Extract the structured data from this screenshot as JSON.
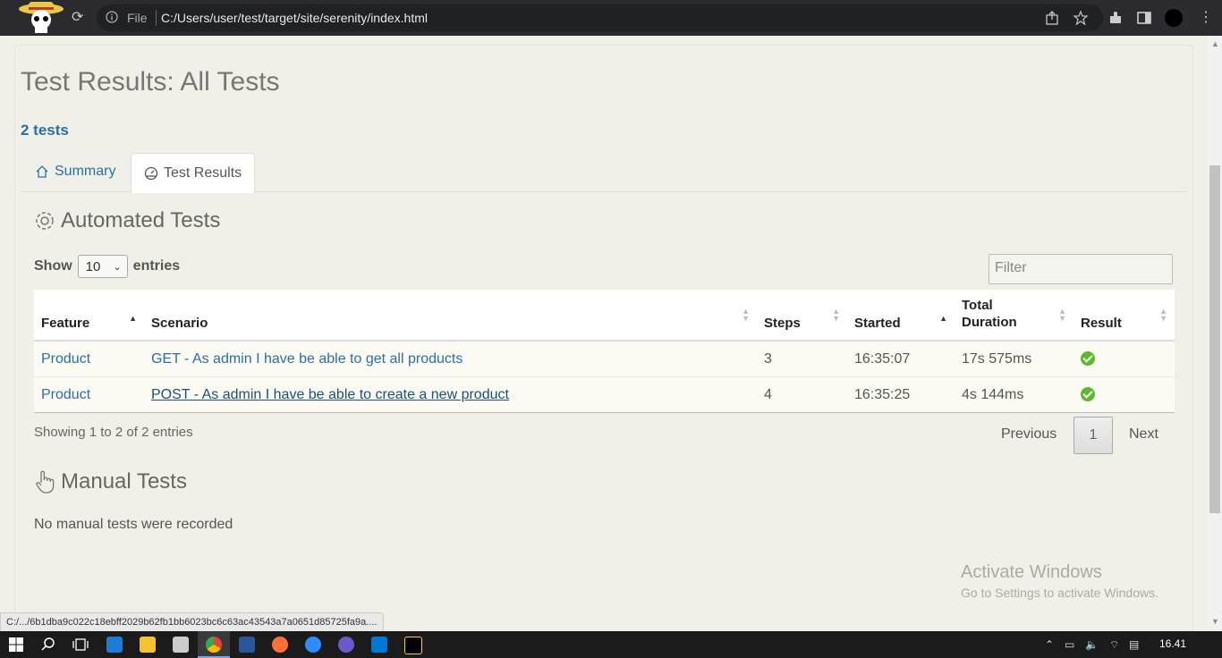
{
  "browser": {
    "file_label": "File",
    "url": "C:/Users/user/test/target/site/serenity/index.html",
    "status_url": "C:/.../6b1dba9c022c18ebff2029b62fb1bb6023bc6c63ac43543a7a0651d85725fa9a...."
  },
  "page": {
    "title": "Test Results: All Tests",
    "test_count": "2 tests",
    "tabs": [
      {
        "label": "Summary",
        "icon": "home-icon"
      },
      {
        "label": "Test Results",
        "icon": "gauge-icon"
      }
    ]
  },
  "automated": {
    "heading": "Automated Tests",
    "show_label": "Show",
    "entries_value": "10",
    "entries_label": "entries",
    "filter_placeholder": "Filter",
    "columns": [
      "Feature",
      "Scenario",
      "Steps",
      "Started",
      "Total Duration",
      "Result"
    ],
    "rows": [
      {
        "feature": "Product",
        "scenario": "GET - As admin I have be able to get all products",
        "steps": "3",
        "started": "16:35:07",
        "duration": "17s 575ms",
        "result": "passed"
      },
      {
        "feature": "Product",
        "scenario": "POST - As admin I have be able to create a new product",
        "steps": "4",
        "started": "16:35:25",
        "duration": "4s 144ms",
        "result": "passed"
      }
    ],
    "showing_text": "Showing 1 to 2 of 2 entries",
    "pager": {
      "previous": "Previous",
      "page": "1",
      "next": "Next"
    }
  },
  "manual": {
    "heading": "Manual Tests",
    "empty_text": "No manual tests were recorded"
  },
  "watermark": {
    "line1": "Activate Windows",
    "line2": "Go to Settings to activate Windows."
  },
  "taskbar": {
    "clock": "16.41"
  },
  "colors": {
    "link": "#2a6fa8",
    "pass": "#5cb82f",
    "page_bg": "#f0f0e8"
  }
}
